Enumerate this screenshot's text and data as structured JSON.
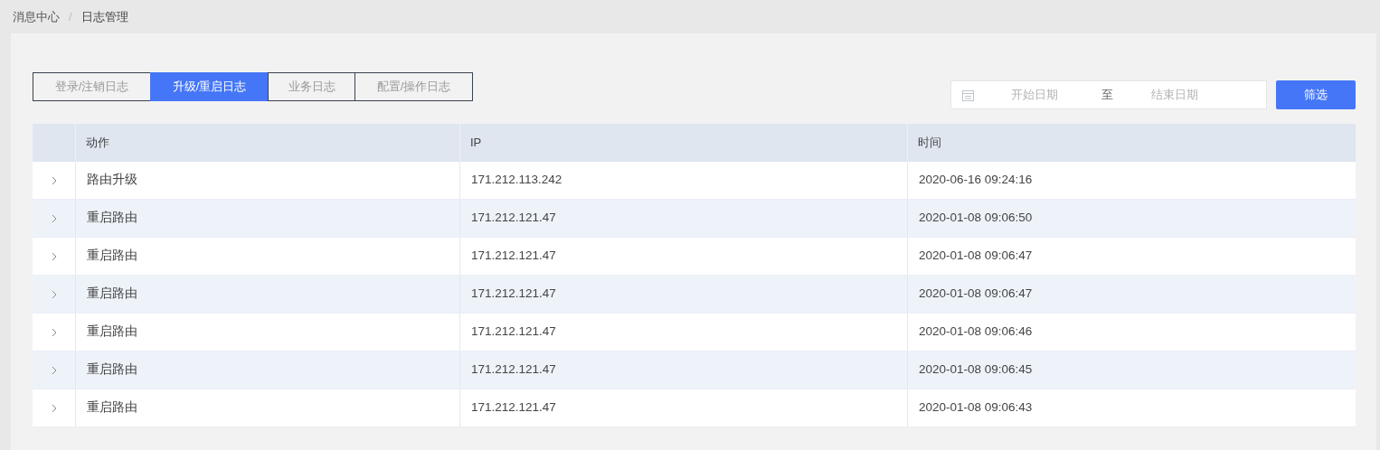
{
  "breadcrumb": [
    "消息中心",
    "日志管理"
  ],
  "breadcrumb_separator": "/",
  "tabs": [
    {
      "label": "登录/注销日志",
      "selected": false
    },
    {
      "label": "升级/重启日志",
      "selected": true
    },
    {
      "label": "业务日志",
      "selected": false
    },
    {
      "label": "配置/操作日志",
      "selected": false
    }
  ],
  "date_range": {
    "start_placeholder": "开始日期",
    "separator": "至",
    "end_placeholder": "结束日期"
  },
  "filter_button": "筛选",
  "table": {
    "columns": [
      "动作",
      "IP",
      "时间"
    ],
    "rows": [
      {
        "expanded": false,
        "cells": [
          "路由升级",
          "171.212.113.242",
          "2020-06-16 09:24:16"
        ]
      },
      {
        "expanded": false,
        "cells": [
          "重启路由",
          "171.212.121.47",
          "2020-01-08 09:06:50"
        ]
      },
      {
        "expanded": false,
        "cells": [
          "重启路由",
          "171.212.121.47",
          "2020-01-08 09:06:47"
        ]
      },
      {
        "expanded": false,
        "cells": [
          "重启路由",
          "171.212.121.47",
          "2020-01-08 09:06:47"
        ]
      },
      {
        "expanded": false,
        "cells": [
          "重启路由",
          "171.212.121.47",
          "2020-01-08 09:06:46"
        ]
      },
      {
        "expanded": false,
        "cells": [
          "重启路由",
          "171.212.121.47",
          "2020-01-08 09:06:45"
        ]
      },
      {
        "expanded": false,
        "cells": [
          "重启路由",
          "171.212.121.47",
          "2020-01-08 09:06:43"
        ]
      }
    ]
  }
}
